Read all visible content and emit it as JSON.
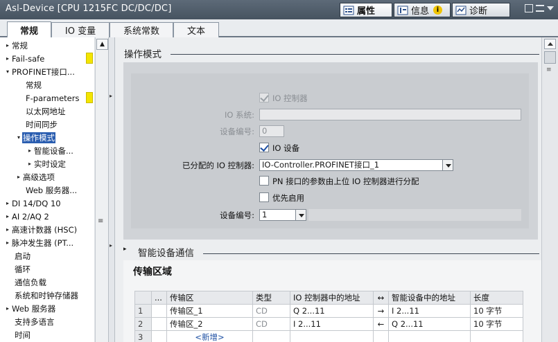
{
  "window": {
    "title": "Asl-Device [CPU 1215FC DC/DC/DC]",
    "tabs": [
      {
        "label": "属性",
        "icon": "properties-icon",
        "active": true
      },
      {
        "label": "信息",
        "icon": "info-icon",
        "active": false
      },
      {
        "label": "诊断",
        "icon": "diagnostics-icon",
        "active": false
      }
    ]
  },
  "subtabs": [
    {
      "label": "常规",
      "active": true
    },
    {
      "label": "IO 变量",
      "active": false
    },
    {
      "label": "系统常数",
      "active": false
    },
    {
      "label": "文本",
      "active": false
    }
  ],
  "nav": {
    "items": [
      {
        "label": "常规",
        "arrow": "▸"
      },
      {
        "label": "Fail-safe",
        "arrow": "▸",
        "warn": true
      },
      {
        "label": "PROFINET接口...",
        "arrow": "▾"
      },
      {
        "label": "常规",
        "arrow": ""
      },
      {
        "label": "F-parameters",
        "arrow": "",
        "warn": true
      },
      {
        "label": "以太网地址",
        "arrow": ""
      },
      {
        "label": "时间同步",
        "arrow": ""
      },
      {
        "label": "操作模式",
        "arrow": "▾",
        "selected": true
      },
      {
        "label": "智能设备...",
        "arrow": "▸"
      },
      {
        "label": "实时设定",
        "arrow": "▸"
      },
      {
        "label": "高级选项",
        "arrow": "▸"
      },
      {
        "label": "Web 服务器...",
        "arrow": ""
      },
      {
        "label": "DI 14/DQ 10",
        "arrow": "▸"
      },
      {
        "label": "AI 2/AQ 2",
        "arrow": "▸"
      },
      {
        "label": "高速计数器 (HSC)",
        "arrow": "▸"
      },
      {
        "label": "脉冲发生器 (PT...",
        "arrow": "▸"
      },
      {
        "label": "启动",
        "arrow": ""
      },
      {
        "label": "循环",
        "arrow": ""
      },
      {
        "label": "通信负载",
        "arrow": ""
      },
      {
        "label": "系统和时钟存储器",
        "arrow": ""
      },
      {
        "label": "Web 服务器",
        "arrow": "▸"
      },
      {
        "label": "支持多语言",
        "arrow": ""
      },
      {
        "label": "时间",
        "arrow": ""
      }
    ]
  },
  "operating_mode": {
    "section_title": "操作模式",
    "io_controller": {
      "label": "IO 控制器",
      "checked": true,
      "enabled": false
    },
    "io_system": {
      "label": "IO 系统:",
      "value": ""
    },
    "device_number_1": {
      "label": "设备编号:",
      "value": "0"
    },
    "io_device": {
      "label": "IO 设备",
      "checked": true
    },
    "assigned_controller": {
      "label": "已分配的 IO 控制器:",
      "value": "IO-Controller.PROFINET接口_1"
    },
    "pn_params": {
      "label": "PN 接口的参数由上位 IO 控制器进行分配",
      "checked": false
    },
    "priority_startup": {
      "label": "优先启用",
      "checked": false
    },
    "device_number_2": {
      "label": "设备编号:",
      "value": "1"
    }
  },
  "intelligent_comm": {
    "section_title": "智能设备通信",
    "transfer_title": "传输区域",
    "columns": [
      "",
      "...",
      "传输区",
      "类型",
      "IO 控制器中的地址",
      "↔",
      "智能设备中的地址",
      "长度"
    ],
    "rows": [
      {
        "no": "1",
        "name": "传输区_1",
        "type": "CD",
        "ctrl_addr": "Q 2...11",
        "dir": "→",
        "dev_addr": "I 2...11",
        "length": "10 字节"
      },
      {
        "no": "2",
        "name": "传输区_2",
        "type": "CD",
        "ctrl_addr": "I 2...11",
        "dir": "←",
        "dev_addr": "Q 2...11",
        "length": "10 字节"
      },
      {
        "no": "3",
        "name": "<新增>",
        "type": "",
        "ctrl_addr": "",
        "dir": "",
        "dev_addr": "",
        "length": ""
      }
    ]
  }
}
